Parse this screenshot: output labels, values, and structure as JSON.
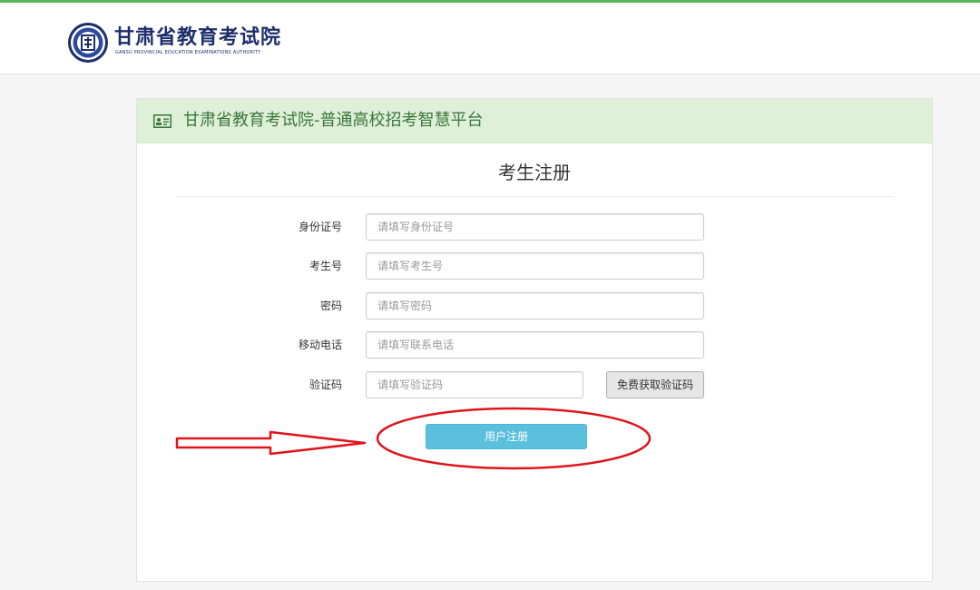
{
  "header": {
    "org_name": "甘肃省教育考试院",
    "org_name_en": "GANSU PROVINCIAL EDUCATION EXAMINATIONS AUTHORITY"
  },
  "panel": {
    "title": "甘肃省教育考试院-普通高校招考智慧平台",
    "icon": "id-card-icon"
  },
  "form": {
    "title": "考生注册",
    "fields": [
      {
        "label": "身份证号",
        "placeholder": "请填写身份证号",
        "value": ""
      },
      {
        "label": "考生号",
        "placeholder": "请填写考生号",
        "value": ""
      },
      {
        "label": "密码",
        "placeholder": "请填写密码",
        "value": ""
      },
      {
        "label": "移动电话",
        "placeholder": "请填写联系电话",
        "value": ""
      },
      {
        "label": "验证码",
        "placeholder": "请填写验证码",
        "value": ""
      }
    ],
    "get_code_label": "免费获取验证码",
    "submit_label": "用户注册"
  },
  "colors": {
    "top_line": "#5cb85c",
    "panel_header_bg": "#dff0d8",
    "panel_header_text": "#3c763d",
    "register_button": "#5bc0de",
    "annotation_red": "#e0141b",
    "logo_blue": "#1d2f6b"
  }
}
